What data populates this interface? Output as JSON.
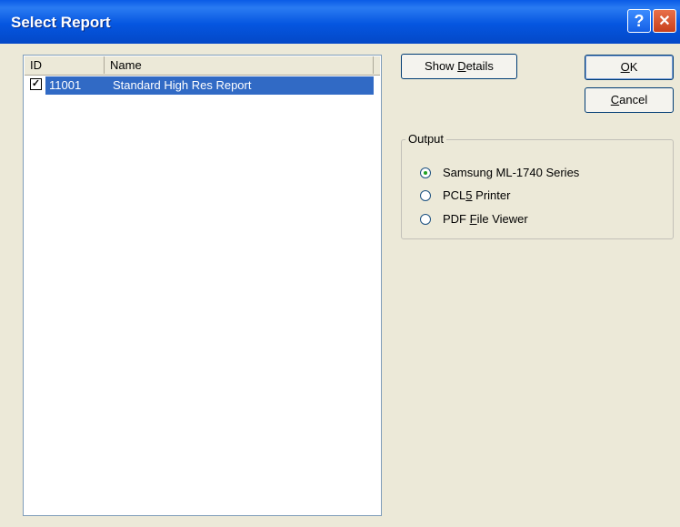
{
  "window": {
    "title": "Select Report",
    "help_glyph": "?",
    "close_glyph": "✕"
  },
  "list": {
    "columns": [
      "ID",
      "Name"
    ],
    "rows": [
      {
        "checked": true,
        "id": "11001",
        "name": "Standard High Res Report",
        "selected": true
      }
    ]
  },
  "buttons": {
    "show_details": {
      "pre": "Show ",
      "mnemonic": "D",
      "post": "etails"
    },
    "ok": {
      "pre": "",
      "mnemonic": "O",
      "post": "K"
    },
    "cancel": {
      "pre": "",
      "mnemonic": "C",
      "post": "ancel"
    }
  },
  "output": {
    "legend": "Output",
    "options": [
      {
        "pre": "Samsung ML-1740 Series",
        "mnemonic": "",
        "post": "",
        "checked": true
      },
      {
        "pre": "PCL",
        "mnemonic": "5",
        "post": " Printer",
        "checked": false
      },
      {
        "pre": "PDF ",
        "mnemonic": "F",
        "post": "ile Viewer",
        "checked": false
      }
    ]
  },
  "colors": {
    "titlebar": "#0a5be6",
    "selection": "#316ac5",
    "dialog_bg": "#ece9d8"
  }
}
